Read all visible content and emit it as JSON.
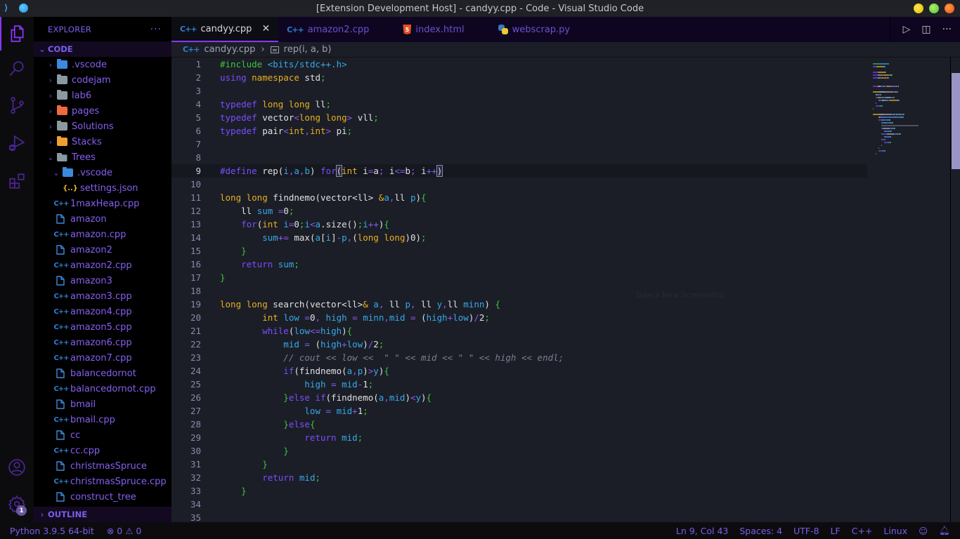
{
  "window": {
    "title": "[Extension Development Host] - candyy.cpp - Code - Visual Studio Code"
  },
  "activity_bar": {
    "items": [
      "explorer",
      "search",
      "source-control",
      "run-debug",
      "extensions"
    ],
    "bottom": [
      "accounts",
      "manage"
    ],
    "manage_badge": "1"
  },
  "sidebar": {
    "header": "EXPLORER",
    "more": "···",
    "root_section": "CODE",
    "tree": [
      {
        "label": ".vscode",
        "type": "folder",
        "icon": "vscode-folder",
        "depth": 0,
        "expanded": false
      },
      {
        "label": "codejam",
        "type": "folder",
        "icon": "folder",
        "depth": 0,
        "expanded": false
      },
      {
        "label": "lab6",
        "type": "folder",
        "icon": "folder",
        "depth": 0,
        "expanded": false
      },
      {
        "label": "pages",
        "type": "folder",
        "icon": "html-folder",
        "depth": 0,
        "expanded": false
      },
      {
        "label": "Solutions",
        "type": "folder",
        "icon": "folder",
        "depth": 0,
        "expanded": false
      },
      {
        "label": "Stacks",
        "type": "folder",
        "icon": "stack-folder",
        "depth": 0,
        "expanded": false
      },
      {
        "label": "Trees",
        "type": "folder",
        "icon": "folder-open",
        "depth": 0,
        "expanded": true
      },
      {
        "label": ".vscode",
        "type": "folder",
        "icon": "vscode-folder",
        "depth": 1,
        "expanded": true
      },
      {
        "label": "settings.json",
        "type": "file",
        "icon": "json",
        "depth": 2
      },
      {
        "label": "1maxHeap.cpp",
        "type": "file",
        "icon": "cpp",
        "depth": 1
      },
      {
        "label": "amazon",
        "type": "file",
        "icon": "file",
        "depth": 1
      },
      {
        "label": "amazon.cpp",
        "type": "file",
        "icon": "cpp",
        "depth": 1
      },
      {
        "label": "amazon2",
        "type": "file",
        "icon": "file",
        "depth": 1
      },
      {
        "label": "amazon2.cpp",
        "type": "file",
        "icon": "cpp",
        "depth": 1
      },
      {
        "label": "amazon3",
        "type": "file",
        "icon": "file",
        "depth": 1
      },
      {
        "label": "amazon3.cpp",
        "type": "file",
        "icon": "cpp",
        "depth": 1
      },
      {
        "label": "amazon4.cpp",
        "type": "file",
        "icon": "cpp",
        "depth": 1
      },
      {
        "label": "amazon5.cpp",
        "type": "file",
        "icon": "cpp",
        "depth": 1
      },
      {
        "label": "amazon6.cpp",
        "type": "file",
        "icon": "cpp",
        "depth": 1
      },
      {
        "label": "amazon7.cpp",
        "type": "file",
        "icon": "cpp",
        "depth": 1
      },
      {
        "label": "balancedornot",
        "type": "file",
        "icon": "file",
        "depth": 1
      },
      {
        "label": "balancedornot.cpp",
        "type": "file",
        "icon": "cpp",
        "depth": 1
      },
      {
        "label": "bmail",
        "type": "file",
        "icon": "file",
        "depth": 1
      },
      {
        "label": "bmail.cpp",
        "type": "file",
        "icon": "cpp",
        "depth": 1
      },
      {
        "label": "cc",
        "type": "file",
        "icon": "file",
        "depth": 1
      },
      {
        "label": "cc.cpp",
        "type": "file",
        "icon": "cpp",
        "depth": 1
      },
      {
        "label": "christmasSpruce",
        "type": "file",
        "icon": "file",
        "depth": 1
      },
      {
        "label": "christmasSpruce.cpp",
        "type": "file",
        "icon": "cpp",
        "depth": 1
      },
      {
        "label": "construct_tree",
        "type": "file",
        "icon": "file",
        "depth": 1
      }
    ],
    "outline_section": "OUTLINE"
  },
  "editor": {
    "tabs": [
      {
        "label": "candyy.cpp",
        "icon": "cpp",
        "active": true
      },
      {
        "label": "amazon2.cpp",
        "icon": "cpp",
        "active": false
      },
      {
        "label": "index.html",
        "icon": "html5",
        "active": false
      },
      {
        "label": "webscrap.py",
        "icon": "python",
        "active": false
      }
    ],
    "breadcrumb": {
      "file": "candyy.cpp",
      "symbol": "rep(i, a, b)"
    },
    "current_line": 9,
    "lines": [
      [
        [
          "inc",
          "#include "
        ],
        [
          "hdr",
          "<bits/stdc++.h>"
        ]
      ],
      [
        [
          "k",
          "using "
        ],
        [
          "t",
          "namespace "
        ],
        [
          "p",
          "std"
        ],
        [
          "s",
          ";"
        ]
      ],
      [],
      [
        [
          "k",
          "typedef "
        ],
        [
          "t",
          "long long "
        ],
        [
          "p",
          "ll"
        ],
        [
          "s",
          ";"
        ]
      ],
      [
        [
          "k",
          "typedef "
        ],
        [
          "p",
          "vector"
        ],
        [
          "o",
          "<"
        ],
        [
          "t",
          "long long"
        ],
        [
          "o",
          "> "
        ],
        [
          "p",
          "vll"
        ],
        [
          "s",
          ";"
        ]
      ],
      [
        [
          "k",
          "typedef "
        ],
        [
          "p",
          "pair"
        ],
        [
          "o",
          "<"
        ],
        [
          "t",
          "int"
        ],
        [
          "o",
          ","
        ],
        [
          "t",
          "int"
        ],
        [
          "o",
          "> "
        ],
        [
          "p",
          "pi"
        ],
        [
          "s",
          ";"
        ]
      ],
      [],
      [],
      [
        [
          "k",
          "#define "
        ],
        [
          "f",
          "rep"
        ],
        [
          "p",
          "("
        ],
        [
          "v",
          "i"
        ],
        [
          "o",
          ","
        ],
        [
          "v",
          "a"
        ],
        [
          "o",
          ","
        ],
        [
          "v",
          "b"
        ],
        [
          "p",
          ") "
        ],
        [
          "k",
          "for"
        ],
        [
          "bm",
          "("
        ],
        [
          "t",
          "int "
        ],
        [
          "p",
          "i"
        ],
        [
          "o",
          "="
        ],
        [
          "p",
          "a"
        ],
        [
          "o",
          "; "
        ],
        [
          "p",
          "i"
        ],
        [
          "o",
          "<="
        ],
        [
          "p",
          "b"
        ],
        [
          "o",
          "; "
        ],
        [
          "p",
          "i"
        ],
        [
          "o",
          "++"
        ],
        [
          "bm",
          ")"
        ]
      ],
      [],
      [
        [
          "t",
          "long long "
        ],
        [
          "f",
          "findnemo"
        ],
        [
          "p",
          "(vector<ll> "
        ],
        [
          "t",
          "&"
        ],
        [
          "v",
          "a"
        ],
        [
          "o",
          ","
        ],
        [
          "p",
          "ll "
        ],
        [
          "v",
          "p"
        ],
        [
          "p",
          ")"
        ],
        [
          "br",
          "{"
        ]
      ],
      [
        [
          "p",
          "    ll "
        ],
        [
          "v",
          "sum "
        ],
        [
          "o",
          "="
        ],
        [
          "p",
          "0"
        ],
        [
          "s",
          ";"
        ]
      ],
      [
        [
          "k",
          "    for"
        ],
        [
          "p",
          "("
        ],
        [
          "t",
          "int "
        ],
        [
          "v",
          "i"
        ],
        [
          "o",
          "="
        ],
        [
          "p",
          "0"
        ],
        [
          "s",
          ";"
        ],
        [
          "v",
          "i"
        ],
        [
          "o",
          "<"
        ],
        [
          "v",
          "a"
        ],
        [
          "p",
          ".size()"
        ],
        [
          "s",
          ";"
        ],
        [
          "v",
          "i"
        ],
        [
          "o",
          "++"
        ],
        [
          "p",
          ")"
        ],
        [
          "br",
          "{"
        ]
      ],
      [
        [
          "v",
          "        sum"
        ],
        [
          "o",
          "+= "
        ],
        [
          "f",
          "max"
        ],
        [
          "p",
          "("
        ],
        [
          "v",
          "a"
        ],
        [
          "p",
          "["
        ],
        [
          "v",
          "i"
        ],
        [
          "p",
          "]"
        ],
        [
          "o",
          "-"
        ],
        [
          "v",
          "p"
        ],
        [
          "o",
          ","
        ],
        [
          "p",
          "("
        ],
        [
          "t",
          "long long"
        ],
        [
          "p",
          ")0)"
        ],
        [
          "s",
          ";"
        ]
      ],
      [
        [
          "br",
          "    }"
        ]
      ],
      [
        [
          "k",
          "    return "
        ],
        [
          "v",
          "sum"
        ],
        [
          "s",
          ";"
        ]
      ],
      [
        [
          "br",
          "}"
        ]
      ],
      [],
      [
        [
          "t",
          "long long "
        ],
        [
          "f",
          "search"
        ],
        [
          "p",
          "(vector<ll>"
        ],
        [
          "t",
          "& "
        ],
        [
          "v",
          "a"
        ],
        [
          "o",
          ", "
        ],
        [
          "p",
          "ll "
        ],
        [
          "v",
          "p"
        ],
        [
          "o",
          ", "
        ],
        [
          "p",
          "ll "
        ],
        [
          "v",
          "y"
        ],
        [
          "o",
          ","
        ],
        [
          "p",
          "ll "
        ],
        [
          "v",
          "minn"
        ],
        [
          "p",
          ") "
        ],
        [
          "br",
          "{"
        ]
      ],
      [
        [
          "t",
          "        int "
        ],
        [
          "v",
          "low "
        ],
        [
          "o",
          "="
        ],
        [
          "p",
          "0"
        ],
        [
          "o",
          ", "
        ],
        [
          "v",
          "high "
        ],
        [
          "o",
          "= "
        ],
        [
          "v",
          "minn"
        ],
        [
          "o",
          ","
        ],
        [
          "v",
          "mid "
        ],
        [
          "o",
          "= "
        ],
        [
          "p",
          "("
        ],
        [
          "v",
          "high"
        ],
        [
          "o",
          "+"
        ],
        [
          "v",
          "low"
        ],
        [
          "p",
          ")"
        ],
        [
          "o",
          "/"
        ],
        [
          "p",
          "2"
        ],
        [
          "s",
          ";"
        ]
      ],
      [
        [
          "k",
          "        while"
        ],
        [
          "p",
          "("
        ],
        [
          "v",
          "low"
        ],
        [
          "o",
          "<="
        ],
        [
          "v",
          "high"
        ],
        [
          "p",
          ")"
        ],
        [
          "br",
          "{"
        ]
      ],
      [
        [
          "v",
          "            mid "
        ],
        [
          "o",
          "= "
        ],
        [
          "p",
          "("
        ],
        [
          "v",
          "high"
        ],
        [
          "o",
          "+"
        ],
        [
          "v",
          "low"
        ],
        [
          "p",
          ")"
        ],
        [
          "o",
          "/"
        ],
        [
          "p",
          "2"
        ],
        [
          "s",
          ";"
        ]
      ],
      [
        [
          "c",
          "            // cout << low <<  \" \" << mid << \" \" << high << endl;"
        ]
      ],
      [
        [
          "k",
          "            if"
        ],
        [
          "p",
          "(findnemo("
        ],
        [
          "v",
          "a"
        ],
        [
          "o",
          ","
        ],
        [
          "v",
          "p"
        ],
        [
          "p",
          ")"
        ],
        [
          "o",
          ">"
        ],
        [
          "v",
          "y"
        ],
        [
          "p",
          ")"
        ],
        [
          "br",
          "{"
        ]
      ],
      [
        [
          "v",
          "                high "
        ],
        [
          "o",
          "= "
        ],
        [
          "v",
          "mid"
        ],
        [
          "o",
          "-"
        ],
        [
          "p",
          "1"
        ],
        [
          "s",
          ";"
        ]
      ],
      [
        [
          "br",
          "            }"
        ],
        [
          "k",
          "else if"
        ],
        [
          "p",
          "(findnemo("
        ],
        [
          "v",
          "a"
        ],
        [
          "o",
          ","
        ],
        [
          "v",
          "mid"
        ],
        [
          "p",
          ")"
        ],
        [
          "o",
          "<"
        ],
        [
          "v",
          "y"
        ],
        [
          "p",
          ")"
        ],
        [
          "br",
          "{"
        ]
      ],
      [
        [
          "v",
          "                low "
        ],
        [
          "o",
          "= "
        ],
        [
          "v",
          "mid"
        ],
        [
          "o",
          "+"
        ],
        [
          "p",
          "1"
        ],
        [
          "s",
          ";"
        ]
      ],
      [
        [
          "br",
          "            }"
        ],
        [
          "k",
          "else"
        ],
        [
          "br",
          "{"
        ]
      ],
      [
        [
          "k",
          "                return "
        ],
        [
          "v",
          "mid"
        ],
        [
          "s",
          ";"
        ]
      ],
      [
        [
          "br",
          "            }"
        ]
      ],
      [
        [
          "br",
          "        }"
        ]
      ],
      [
        [
          "k",
          "        return "
        ],
        [
          "v",
          "mid"
        ],
        [
          "s",
          ";"
        ]
      ],
      [
        [
          "br",
          "    }"
        ]
      ],
      [],
      []
    ],
    "watermark": "Take a New Screenshot"
  },
  "statusbar": {
    "python": "Python 3.9.5 64-bit",
    "errors": "0",
    "warnings": "0",
    "position": "Ln 9, Col 43",
    "spaces": "Spaces: 4",
    "encoding": "UTF-8",
    "eol": "LF",
    "language": "C++",
    "os": "Linux"
  },
  "colors": {
    "accent": "#8a35ff",
    "sidebar_text": "#7d5ee8",
    "editor_bg": "#1b1e27"
  }
}
